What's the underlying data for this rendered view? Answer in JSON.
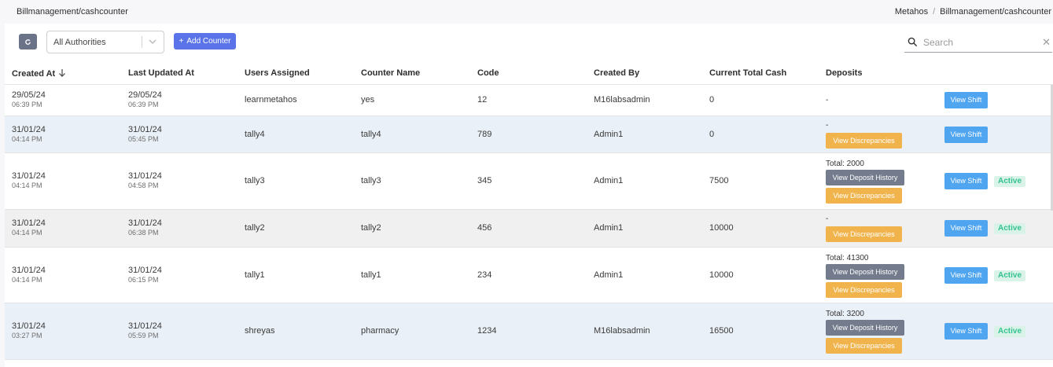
{
  "header": {
    "page_heading": "Billmanagement/cashcounter",
    "breadcrumb": [
      "Metahos",
      "/",
      "Billmanagement/cashcounter"
    ]
  },
  "toolbar": {
    "refresh_icon": "refresh-icon",
    "authority_select": "All Authorities",
    "add_counter_label": "Add Counter",
    "search_placeholder": "Search"
  },
  "table": {
    "columns": [
      "Created At",
      "Last Updated At",
      "Users Assigned",
      "Counter Name",
      "Code",
      "Created By",
      "Current Total Cash",
      "Deposits"
    ],
    "sort_column": "Created At",
    "rows": [
      {
        "created_date": "29/05/24",
        "created_time": "06:39 PM",
        "updated_date": "29/05/24",
        "updated_time": "06:39 PM",
        "user": "learnmetahos",
        "counter": "yes",
        "code": "12",
        "created_by": "M16labsadmin",
        "cash": "0",
        "deposit_text": "-",
        "history_label": "",
        "disc_label": "",
        "shift_label": "View Shift",
        "status": ""
      },
      {
        "created_date": "31/01/24",
        "created_time": "04:14 PM",
        "updated_date": "31/01/24",
        "updated_time": "05:45 PM",
        "user": "tally4",
        "counter": "tally4",
        "code": "789",
        "created_by": "Admin1",
        "cash": "0",
        "deposit_text": "-",
        "history_label": "",
        "disc_label": "View Discrepancies",
        "shift_label": "View Shift",
        "status": ""
      },
      {
        "created_date": "31/01/24",
        "created_time": "04:14 PM",
        "updated_date": "31/01/24",
        "updated_time": "04:58 PM",
        "user": "tally3",
        "counter": "tally3",
        "code": "345",
        "created_by": "Admin1",
        "cash": "7500",
        "deposit_text": "Total: 2000",
        "history_label": "View Deposit History",
        "disc_label": "View Discrepancies",
        "shift_label": "View Shift",
        "status": "Active"
      },
      {
        "created_date": "31/01/24",
        "created_time": "04:14 PM",
        "updated_date": "31/01/24",
        "updated_time": "06:38 PM",
        "user": "tally2",
        "counter": "tally2",
        "code": "456",
        "created_by": "Admin1",
        "cash": "10000",
        "deposit_text": "-",
        "history_label": "",
        "disc_label": "View Discrepancies",
        "shift_label": "View Shift",
        "status": "Active"
      },
      {
        "created_date": "31/01/24",
        "created_time": "04:14 PM",
        "updated_date": "31/01/24",
        "updated_time": "06:15 PM",
        "user": "tally1",
        "counter": "tally1",
        "code": "234",
        "created_by": "Admin1",
        "cash": "10000",
        "deposit_text": "Total: 41300",
        "history_label": "View Deposit History",
        "disc_label": "View Discrepancies",
        "shift_label": "View Shift",
        "status": "Active"
      },
      {
        "created_date": "31/01/24",
        "created_time": "03:27 PM",
        "updated_date": "31/01/24",
        "updated_time": "05:59 PM",
        "user": "shreyas",
        "counter": "pharmacy",
        "code": "1234",
        "created_by": "M16labsadmin",
        "cash": "16500",
        "deposit_text": "Total: 3200",
        "history_label": "View Deposit History",
        "disc_label": "View Discrepancies",
        "shift_label": "View Shift",
        "status": "Active"
      }
    ]
  },
  "colors": {
    "primary": "#5b73e8",
    "info": "#50a5f1",
    "warning": "#f1b44c",
    "success": "#34c38f",
    "secondary": "#737b8c"
  }
}
